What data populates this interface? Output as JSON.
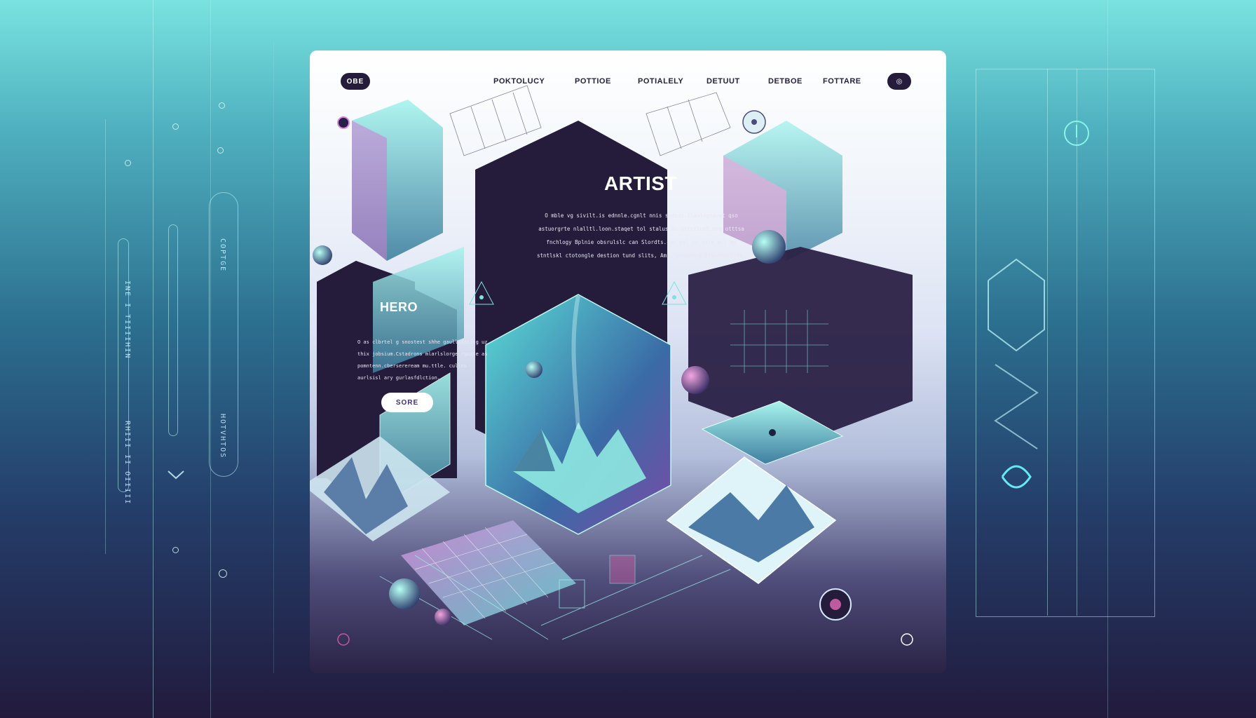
{
  "nav": {
    "logo": "OBE",
    "items": [
      "POKTOLUCY",
      "POTTIOE",
      "POTIALELY",
      "DETUUT",
      "DETBOE",
      "FOTTARE"
    ],
    "circle": "◎"
  },
  "artist": {
    "title": "ARTIST",
    "body": "O mble vg sivilt.is ednnle.cgnlt nnis suduns llanlognavet qso astuorgrte nlalltl.loon.staqet tol stalus.do strotlunt urs otttsa fnchlogy Bplnie obsrulslc can Slordts.can pol no sore mil ma stntlskl ctotongle destion tund slits, Ams, glonhing Sraonlarsite."
  },
  "hero": {
    "title": "HERO",
    "body": "O as clbrtel g snostest shhe gaullitating uz thix jobsium.Cstadrons mlarlslorge rguzde as pomntenn.cbersereream mu.ttle. cullns aurlsisl ary gurlasfdlction.",
    "button": "SORE"
  },
  "side": {
    "left_pill": "COPTGE",
    "left_pill2": "HOTVHTOS",
    "left_text1": "INE I TIIIIHIN",
    "left_text2": "RHIII II OIIIII"
  },
  "colors": {
    "accent": "#7af0e8",
    "dark": "#241c3a",
    "magenta": "#c46bd4"
  }
}
